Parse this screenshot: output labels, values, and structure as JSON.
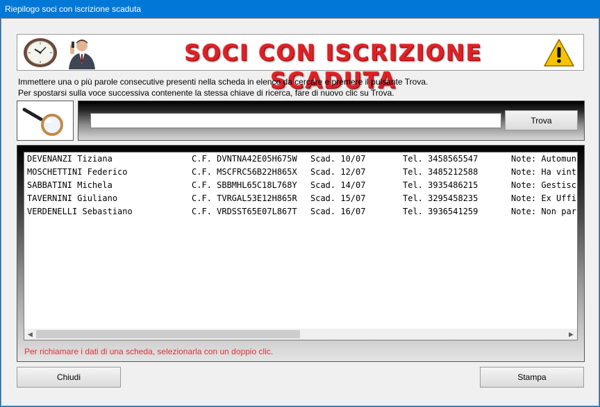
{
  "window": {
    "title": "Riepilogo soci con iscrizione scaduta"
  },
  "banner": {
    "title": "SOCI CON ISCRIZIONE SCADUTA"
  },
  "instructions": {
    "line1": "Immettere una o più parole consecutive presenti nella scheda in elenco da cercare e premere il pulsante Trova.",
    "line2": "Per spostarsi sulla voce successiva contenente la stessa chiave di ricerca, fare di nuovo clic su Trova."
  },
  "search": {
    "value": "",
    "button_label": "Trova"
  },
  "list": {
    "rows": [
      {
        "name": "DEVENANZI Tiziana",
        "cf": "C.F. DVNTNA42E05H675W",
        "scad": "Scad. 10/07",
        "tel": "Tel. 3458565547",
        "note": "Note: Automun"
      },
      {
        "name": "MOSCHETTINI Federico",
        "cf": "C.F. MSCFRC56B22H865X",
        "scad": "Scad. 12/07",
        "tel": "Tel. 3485212588",
        "note": "Note: Ha vint"
      },
      {
        "name": "SABBATINI Michela",
        "cf": "C.F. SBBMHL65C18L768Y",
        "scad": "Scad. 14/07",
        "tel": "Tel. 3935486215",
        "note": "Note: Gestisc"
      },
      {
        "name": "TAVERNINI Giuliano",
        "cf": "C.F. TVRGAL53E12H865R",
        "scad": "Scad. 15/07",
        "tel": "Tel. 3295458235",
        "note": "Note: Ex Uffi"
      },
      {
        "name": "VERDENELLI Sebastiano",
        "cf": "C.F. VRDSST65E07L867T",
        "scad": "Scad. 16/07",
        "tel": "Tel. 3936541259",
        "note": "Note: Non par"
      }
    ],
    "hint": "Per richiamare i dati di una scheda, selezionarla con un doppio clic."
  },
  "buttons": {
    "close_label": "Chiudi",
    "print_label": "Stampa"
  },
  "icons": {
    "clock": "clock-icon",
    "businessman": "businessman-icon",
    "warning": "warning-icon",
    "magnifier": "magnifier-icon"
  },
  "colors": {
    "titlebar": "#0078d7",
    "banner_text": "#e02025",
    "hint_text": "#e0303a"
  }
}
